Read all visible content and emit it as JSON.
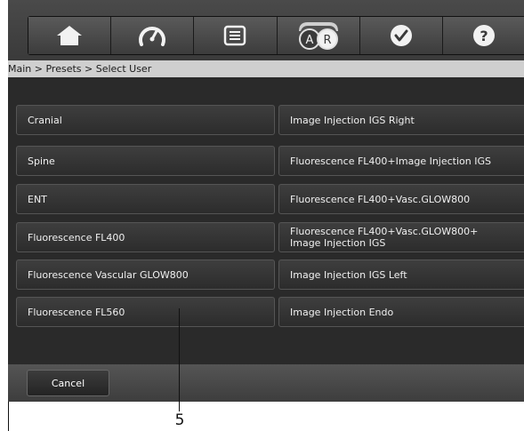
{
  "toolbar": {
    "icons": [
      "home-icon",
      "speedometer-icon",
      "list-icon",
      "ar-toggle-icon",
      "check-icon",
      "help-icon"
    ],
    "ar_letters": [
      "A",
      "R"
    ],
    "help_glyph": "?"
  },
  "breadcrumb": "Main > Presets > Select User",
  "presets": {
    "left": [
      "Cranial",
      "Spine",
      "ENT",
      "Fluorescence FL400",
      "Fluorescence Vascular GLOW800",
      "Fluorescence FL560"
    ],
    "right": [
      "Image Injection IGS Right",
      "Fluorescence FL400+Image Injection IGS",
      "Fluorescence FL400+Vasc.GLOW800",
      "Fluorescence FL400+Vasc.GLOW800+\nImage Injection IGS",
      "Image Injection IGS Left",
      "Image Injection Endo"
    ]
  },
  "footer": {
    "cancel_label": "Cancel"
  },
  "callout": {
    "number": "5"
  },
  "colors": {
    "screen_bg": "#2a2a2a",
    "breadcrumb_bg": "#cfcfcf",
    "button_text": "#f0f0f0"
  }
}
